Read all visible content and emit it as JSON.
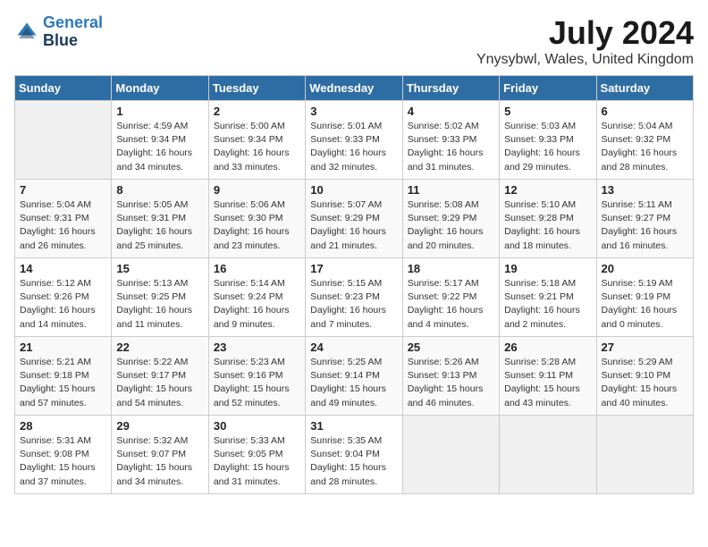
{
  "header": {
    "logo_line1": "General",
    "logo_line2": "Blue",
    "month": "July 2024",
    "location": "Ynysybwl, Wales, United Kingdom"
  },
  "weekdays": [
    "Sunday",
    "Monday",
    "Tuesday",
    "Wednesday",
    "Thursday",
    "Friday",
    "Saturday"
  ],
  "weeks": [
    [
      {
        "day": "",
        "info": ""
      },
      {
        "day": "1",
        "info": "Sunrise: 4:59 AM\nSunset: 9:34 PM\nDaylight: 16 hours\nand 34 minutes."
      },
      {
        "day": "2",
        "info": "Sunrise: 5:00 AM\nSunset: 9:34 PM\nDaylight: 16 hours\nand 33 minutes."
      },
      {
        "day": "3",
        "info": "Sunrise: 5:01 AM\nSunset: 9:33 PM\nDaylight: 16 hours\nand 32 minutes."
      },
      {
        "day": "4",
        "info": "Sunrise: 5:02 AM\nSunset: 9:33 PM\nDaylight: 16 hours\nand 31 minutes."
      },
      {
        "day": "5",
        "info": "Sunrise: 5:03 AM\nSunset: 9:33 PM\nDaylight: 16 hours\nand 29 minutes."
      },
      {
        "day": "6",
        "info": "Sunrise: 5:04 AM\nSunset: 9:32 PM\nDaylight: 16 hours\nand 28 minutes."
      }
    ],
    [
      {
        "day": "7",
        "info": "Sunrise: 5:04 AM\nSunset: 9:31 PM\nDaylight: 16 hours\nand 26 minutes."
      },
      {
        "day": "8",
        "info": "Sunrise: 5:05 AM\nSunset: 9:31 PM\nDaylight: 16 hours\nand 25 minutes."
      },
      {
        "day": "9",
        "info": "Sunrise: 5:06 AM\nSunset: 9:30 PM\nDaylight: 16 hours\nand 23 minutes."
      },
      {
        "day": "10",
        "info": "Sunrise: 5:07 AM\nSunset: 9:29 PM\nDaylight: 16 hours\nand 21 minutes."
      },
      {
        "day": "11",
        "info": "Sunrise: 5:08 AM\nSunset: 9:29 PM\nDaylight: 16 hours\nand 20 minutes."
      },
      {
        "day": "12",
        "info": "Sunrise: 5:10 AM\nSunset: 9:28 PM\nDaylight: 16 hours\nand 18 minutes."
      },
      {
        "day": "13",
        "info": "Sunrise: 5:11 AM\nSunset: 9:27 PM\nDaylight: 16 hours\nand 16 minutes."
      }
    ],
    [
      {
        "day": "14",
        "info": "Sunrise: 5:12 AM\nSunset: 9:26 PM\nDaylight: 16 hours\nand 14 minutes."
      },
      {
        "day": "15",
        "info": "Sunrise: 5:13 AM\nSunset: 9:25 PM\nDaylight: 16 hours\nand 11 minutes."
      },
      {
        "day": "16",
        "info": "Sunrise: 5:14 AM\nSunset: 9:24 PM\nDaylight: 16 hours\nand 9 minutes."
      },
      {
        "day": "17",
        "info": "Sunrise: 5:15 AM\nSunset: 9:23 PM\nDaylight: 16 hours\nand 7 minutes."
      },
      {
        "day": "18",
        "info": "Sunrise: 5:17 AM\nSunset: 9:22 PM\nDaylight: 16 hours\nand 4 minutes."
      },
      {
        "day": "19",
        "info": "Sunrise: 5:18 AM\nSunset: 9:21 PM\nDaylight: 16 hours\nand 2 minutes."
      },
      {
        "day": "20",
        "info": "Sunrise: 5:19 AM\nSunset: 9:19 PM\nDaylight: 16 hours\nand 0 minutes."
      }
    ],
    [
      {
        "day": "21",
        "info": "Sunrise: 5:21 AM\nSunset: 9:18 PM\nDaylight: 15 hours\nand 57 minutes."
      },
      {
        "day": "22",
        "info": "Sunrise: 5:22 AM\nSunset: 9:17 PM\nDaylight: 15 hours\nand 54 minutes."
      },
      {
        "day": "23",
        "info": "Sunrise: 5:23 AM\nSunset: 9:16 PM\nDaylight: 15 hours\nand 52 minutes."
      },
      {
        "day": "24",
        "info": "Sunrise: 5:25 AM\nSunset: 9:14 PM\nDaylight: 15 hours\nand 49 minutes."
      },
      {
        "day": "25",
        "info": "Sunrise: 5:26 AM\nSunset: 9:13 PM\nDaylight: 15 hours\nand 46 minutes."
      },
      {
        "day": "26",
        "info": "Sunrise: 5:28 AM\nSunset: 9:11 PM\nDaylight: 15 hours\nand 43 minutes."
      },
      {
        "day": "27",
        "info": "Sunrise: 5:29 AM\nSunset: 9:10 PM\nDaylight: 15 hours\nand 40 minutes."
      }
    ],
    [
      {
        "day": "28",
        "info": "Sunrise: 5:31 AM\nSunset: 9:08 PM\nDaylight: 15 hours\nand 37 minutes."
      },
      {
        "day": "29",
        "info": "Sunrise: 5:32 AM\nSunset: 9:07 PM\nDaylight: 15 hours\nand 34 minutes."
      },
      {
        "day": "30",
        "info": "Sunrise: 5:33 AM\nSunset: 9:05 PM\nDaylight: 15 hours\nand 31 minutes."
      },
      {
        "day": "31",
        "info": "Sunrise: 5:35 AM\nSunset: 9:04 PM\nDaylight: 15 hours\nand 28 minutes."
      },
      {
        "day": "",
        "info": ""
      },
      {
        "day": "",
        "info": ""
      },
      {
        "day": "",
        "info": ""
      }
    ]
  ]
}
